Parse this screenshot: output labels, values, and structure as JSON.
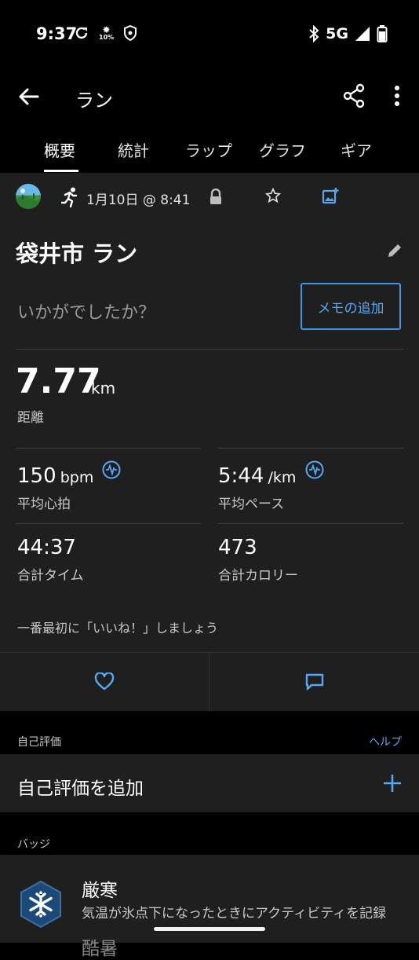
{
  "status_bar": {
    "time": "9:37",
    "network": "5G",
    "indicator_percent": "10%",
    "icons_left": [
      "sync-icon",
      "sun-indicator-icon",
      "shield-icon"
    ],
    "icons_right": [
      "bluetooth-icon",
      "signal-icon",
      "battery-icon"
    ]
  },
  "app_bar": {
    "title": "ラン",
    "back_icon": "arrow-left-icon",
    "share_icon": "share-icon",
    "more_icon": "more-vert-icon"
  },
  "tabs": [
    {
      "label": "概要",
      "active": true
    },
    {
      "label": "統計",
      "active": false
    },
    {
      "label": "ラップ",
      "active": false
    },
    {
      "label": "グラフ",
      "active": false
    },
    {
      "label": "ギア",
      "active": false
    }
  ],
  "activity": {
    "date_time": "1月10日 @ 8:41",
    "title": "袋井市 ラン",
    "how_prompt": "いかがでしたか？",
    "memo_button": "メモの追加",
    "distance": {
      "value": "7.77",
      "unit": "km",
      "label": "距離"
    },
    "stats": [
      {
        "value": "150",
        "unit": "bpm",
        "label": "平均心拍",
        "has_icon": true
      },
      {
        "value": "5:44",
        "unit": "/km",
        "label": "平均ペース",
        "has_icon": true
      },
      {
        "value": "44:37",
        "unit": "",
        "label": "合計タイム",
        "has_icon": false
      },
      {
        "value": "473",
        "unit": "",
        "label": "合計カロリー",
        "has_icon": false
      }
    ],
    "like_prompt": "一番最初に「いいね！」しましょう"
  },
  "self_eval": {
    "section_label": "自己評価",
    "help_link": "ヘルプ",
    "add_label": "自己評価を追加"
  },
  "badges": {
    "section_label": "バッジ",
    "items": [
      {
        "title": "厳寒",
        "description": "気温が氷点下になったときにアクティビティを記録"
      }
    ],
    "next_title": "酷暑"
  },
  "colors": {
    "accent": "#56a8f5",
    "card_bg": "#1f1f1f",
    "page_bg": "#000000"
  }
}
